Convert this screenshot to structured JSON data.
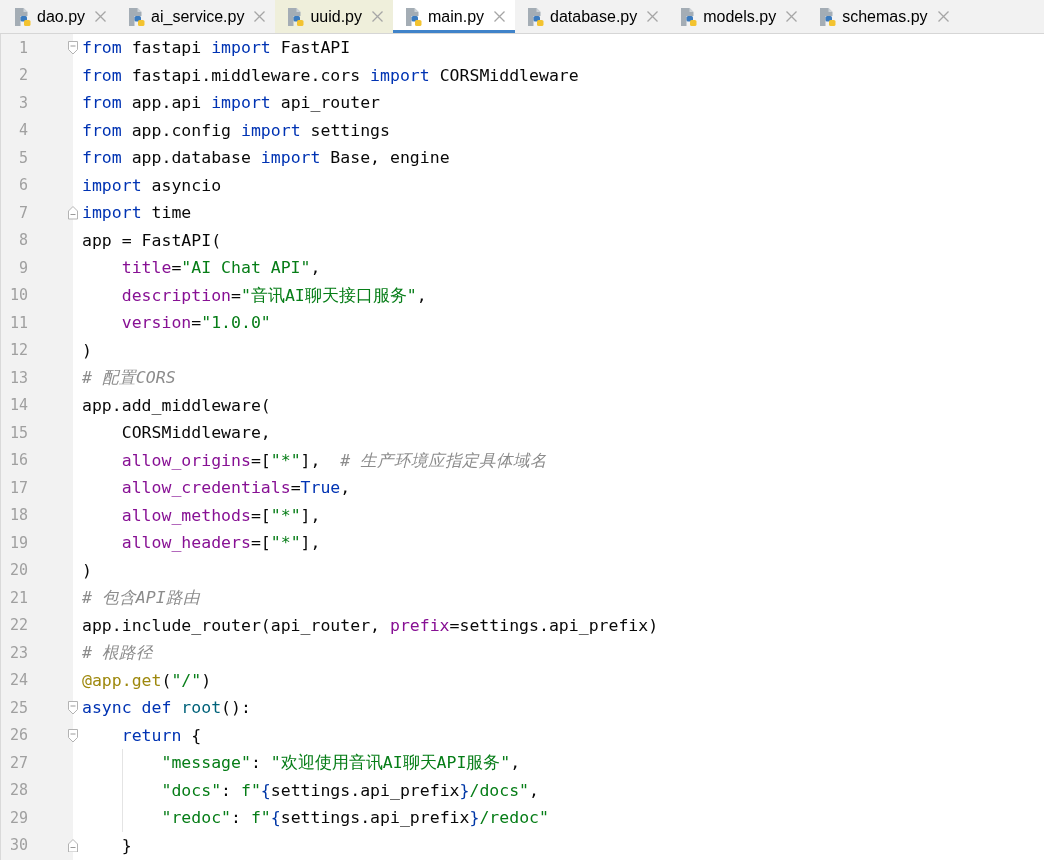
{
  "tabs": [
    {
      "label": "dao.py",
      "selected": false,
      "highlighted": false
    },
    {
      "label": "ai_service.py",
      "selected": false,
      "highlighted": false
    },
    {
      "label": "uuid.py",
      "selected": false,
      "highlighted": true
    },
    {
      "label": "main.py",
      "selected": true,
      "highlighted": false
    },
    {
      "label": "database.py",
      "selected": false,
      "highlighted": false
    },
    {
      "label": "models.py",
      "selected": false,
      "highlighted": false
    },
    {
      "label": "schemas.py",
      "selected": false,
      "highlighted": false
    }
  ],
  "editor": {
    "lines": [
      {
        "number": "1",
        "fold_start": true,
        "fold_end": false,
        "tokens": [
          {
            "text": "from",
            "kind": "keyword"
          },
          {
            "text": " fastapi ",
            "kind": "plain"
          },
          {
            "text": "import",
            "kind": "keyword"
          },
          {
            "text": " FastAPI",
            "kind": "plain"
          }
        ]
      },
      {
        "number": "2",
        "fold_start": false,
        "fold_end": false,
        "tokens": [
          {
            "text": "from",
            "kind": "keyword"
          },
          {
            "text": " fastapi.middleware.cors ",
            "kind": "plain"
          },
          {
            "text": "import",
            "kind": "keyword"
          },
          {
            "text": " CORSMiddleware",
            "kind": "plain"
          }
        ]
      },
      {
        "number": "3",
        "fold_start": false,
        "fold_end": false,
        "tokens": [
          {
            "text": "from",
            "kind": "keyword"
          },
          {
            "text": " app.api ",
            "kind": "plain"
          },
          {
            "text": "import",
            "kind": "keyword"
          },
          {
            "text": " api_router",
            "kind": "plain"
          }
        ]
      },
      {
        "number": "4",
        "fold_start": false,
        "fold_end": false,
        "tokens": [
          {
            "text": "from",
            "kind": "keyword"
          },
          {
            "text": " app.config ",
            "kind": "plain"
          },
          {
            "text": "import",
            "kind": "keyword"
          },
          {
            "text": " settings",
            "kind": "plain"
          }
        ]
      },
      {
        "number": "5",
        "fold_start": false,
        "fold_end": false,
        "tokens": [
          {
            "text": "from",
            "kind": "keyword"
          },
          {
            "text": " app.database ",
            "kind": "plain"
          },
          {
            "text": "import",
            "kind": "keyword"
          },
          {
            "text": " Base, engine",
            "kind": "plain"
          }
        ]
      },
      {
        "number": "6",
        "fold_start": false,
        "fold_end": false,
        "tokens": [
          {
            "text": "import",
            "kind": "keyword"
          },
          {
            "text": " asyncio",
            "kind": "plain"
          }
        ]
      },
      {
        "number": "7",
        "fold_start": false,
        "fold_end": true,
        "tokens": [
          {
            "text": "import",
            "kind": "keyword"
          },
          {
            "text": " time",
            "kind": "plain"
          }
        ]
      },
      {
        "number": "8",
        "fold_start": false,
        "fold_end": false,
        "tokens": [
          {
            "text": "app = FastAPI(",
            "kind": "plain"
          }
        ]
      },
      {
        "number": "9",
        "fold_start": false,
        "fold_end": false,
        "tokens": [
          {
            "text": "    title",
            "kind": "parameter"
          },
          {
            "text": "=",
            "kind": "plain"
          },
          {
            "text": "\"AI Chat API\"",
            "kind": "string"
          },
          {
            "text": ",",
            "kind": "plain"
          }
        ]
      },
      {
        "number": "10",
        "fold_start": false,
        "fold_end": false,
        "tokens": [
          {
            "text": "    description",
            "kind": "parameter"
          },
          {
            "text": "=",
            "kind": "plain"
          },
          {
            "text": "\"音讯AI聊天接口服务\"",
            "kind": "string"
          },
          {
            "text": ",",
            "kind": "plain"
          }
        ]
      },
      {
        "number": "11",
        "fold_start": false,
        "fold_end": false,
        "tokens": [
          {
            "text": "    version",
            "kind": "parameter"
          },
          {
            "text": "=",
            "kind": "plain"
          },
          {
            "text": "\"1.0.0\"",
            "kind": "string"
          }
        ]
      },
      {
        "number": "12",
        "fold_start": false,
        "fold_end": false,
        "tokens": [
          {
            "text": ")",
            "kind": "plain"
          }
        ]
      },
      {
        "number": "13",
        "fold_start": false,
        "fold_end": false,
        "tokens": [
          {
            "text": "# 配置CORS",
            "kind": "comment"
          }
        ]
      },
      {
        "number": "14",
        "fold_start": false,
        "fold_end": false,
        "tokens": [
          {
            "text": "app.add_middleware(",
            "kind": "plain"
          }
        ]
      },
      {
        "number": "15",
        "fold_start": false,
        "fold_end": false,
        "tokens": [
          {
            "text": "    CORSMiddleware,",
            "kind": "plain"
          }
        ]
      },
      {
        "number": "16",
        "fold_start": false,
        "fold_end": false,
        "tokens": [
          {
            "text": "    allow_origins",
            "kind": "parameter"
          },
          {
            "text": "=[",
            "kind": "plain"
          },
          {
            "text": "\"*\"",
            "kind": "string"
          },
          {
            "text": "],  ",
            "kind": "plain"
          },
          {
            "text": "# 生产环境应指定具体域名",
            "kind": "comment"
          }
        ]
      },
      {
        "number": "17",
        "fold_start": false,
        "fold_end": false,
        "tokens": [
          {
            "text": "    allow_credentials",
            "kind": "parameter"
          },
          {
            "text": "=",
            "kind": "plain"
          },
          {
            "text": "True",
            "kind": "keyword"
          },
          {
            "text": ",",
            "kind": "plain"
          }
        ]
      },
      {
        "number": "18",
        "fold_start": false,
        "fold_end": false,
        "tokens": [
          {
            "text": "    allow_methods",
            "kind": "parameter"
          },
          {
            "text": "=[",
            "kind": "plain"
          },
          {
            "text": "\"*\"",
            "kind": "string"
          },
          {
            "text": "],",
            "kind": "plain"
          }
        ]
      },
      {
        "number": "19",
        "fold_start": false,
        "fold_end": false,
        "tokens": [
          {
            "text": "    allow_headers",
            "kind": "parameter"
          },
          {
            "text": "=[",
            "kind": "plain"
          },
          {
            "text": "\"*\"",
            "kind": "string"
          },
          {
            "text": "],",
            "kind": "plain"
          }
        ]
      },
      {
        "number": "20",
        "fold_start": false,
        "fold_end": false,
        "tokens": [
          {
            "text": ")",
            "kind": "plain"
          }
        ]
      },
      {
        "number": "21",
        "fold_start": false,
        "fold_end": false,
        "tokens": [
          {
            "text": "# 包含API路由",
            "kind": "comment"
          }
        ]
      },
      {
        "number": "22",
        "fold_start": false,
        "fold_end": false,
        "tokens": [
          {
            "text": "app.include_router(api_router, ",
            "kind": "plain"
          },
          {
            "text": "prefix",
            "kind": "parameter"
          },
          {
            "text": "=settings.api_prefix)",
            "kind": "plain"
          }
        ]
      },
      {
        "number": "23",
        "fold_start": false,
        "fold_end": false,
        "tokens": [
          {
            "text": "# 根路径",
            "kind": "comment"
          }
        ]
      },
      {
        "number": "24",
        "fold_start": false,
        "fold_end": false,
        "tokens": [
          {
            "text": "@app.get",
            "kind": "decorator"
          },
          {
            "text": "(",
            "kind": "plain"
          },
          {
            "text": "\"/\"",
            "kind": "string"
          },
          {
            "text": ")",
            "kind": "plain"
          }
        ]
      },
      {
        "number": "25",
        "fold_start": true,
        "fold_end": false,
        "tokens": [
          {
            "text": "async def ",
            "kind": "keyword"
          },
          {
            "text": "root",
            "kind": "function"
          },
          {
            "text": "():",
            "kind": "plain"
          }
        ]
      },
      {
        "number": "26",
        "fold_start": true,
        "fold_end": false,
        "tokens": [
          {
            "text": "    return",
            "kind": "keyword"
          },
          {
            "text": " {",
            "kind": "plain"
          }
        ]
      },
      {
        "number": "27",
        "fold_start": false,
        "fold_end": false,
        "tokens": [
          {
            "text": "        \"message\"",
            "kind": "string"
          },
          {
            "text": ": ",
            "kind": "plain"
          },
          {
            "text": "\"欢迎使用音讯AI聊天API服务\"",
            "kind": "string"
          },
          {
            "text": ",",
            "kind": "plain"
          }
        ]
      },
      {
        "number": "28",
        "fold_start": false,
        "fold_end": false,
        "tokens": [
          {
            "text": "        \"docs\"",
            "kind": "string"
          },
          {
            "text": ": ",
            "kind": "plain"
          },
          {
            "text": "f\"",
            "kind": "string"
          },
          {
            "text": "{",
            "kind": "brace"
          },
          {
            "text": "settings.api_prefix",
            "kind": "plain"
          },
          {
            "text": "}",
            "kind": "brace"
          },
          {
            "text": "/docs\"",
            "kind": "string"
          },
          {
            "text": ",",
            "kind": "plain"
          }
        ]
      },
      {
        "number": "29",
        "fold_start": false,
        "fold_end": false,
        "tokens": [
          {
            "text": "        \"redoc\"",
            "kind": "string"
          },
          {
            "text": ": ",
            "kind": "plain"
          },
          {
            "text": "f\"",
            "kind": "string"
          },
          {
            "text": "{",
            "kind": "brace"
          },
          {
            "text": "settings.api_prefix",
            "kind": "plain"
          },
          {
            "text": "}",
            "kind": "brace"
          },
          {
            "text": "/redoc\"",
            "kind": "string"
          }
        ]
      },
      {
        "number": "30",
        "fold_start": false,
        "fold_end": true,
        "tokens": [
          {
            "text": "    }",
            "kind": "plain"
          }
        ]
      }
    ]
  }
}
